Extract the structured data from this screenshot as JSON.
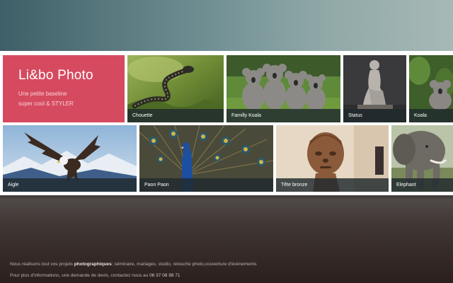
{
  "brand": {
    "title": "Li&bo Photo",
    "subtitle_line1": "Une petite baseline",
    "subtitle_line2": "super cool & STYLER"
  },
  "gallery": {
    "row1": [
      {
        "caption": "Chouette",
        "icon": "snake-photo"
      },
      {
        "caption": "Familly Koala",
        "icon": "koala-family-photo"
      },
      {
        "caption": "Status",
        "icon": "statue-photo"
      },
      {
        "caption": "Koala",
        "icon": "koala-photo"
      }
    ],
    "row2": [
      {
        "caption": "Aigle",
        "icon": "eagle-photo"
      },
      {
        "caption": "Paon Paon",
        "icon": "peacock-photo"
      },
      {
        "caption": "Tête bronze",
        "icon": "bronze-head-photo"
      },
      {
        "caption": "Elephant",
        "icon": "elephant-photo"
      }
    ]
  },
  "footer": {
    "line1_prefix": "Nous réalisons tout vos projets ",
    "line1_strong": "photographiques",
    "line1_suffix": ": séminaire, mariages, studio, retouche photo,couverture d'évènements",
    "line2_prefix": "Pour plus d'informations, une demande de devis, contactez nous au ",
    "line2_phone": "06 37 08 98 71"
  },
  "colors": {
    "brand": "#d64a5f",
    "caption_bg": "#202a2e",
    "gallery_bg": "#ffffff"
  }
}
